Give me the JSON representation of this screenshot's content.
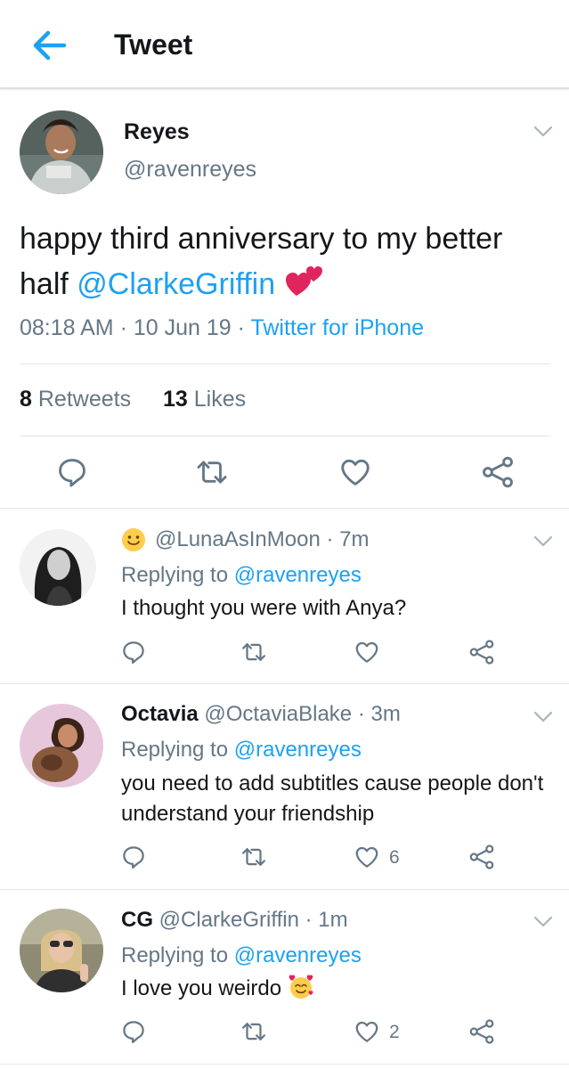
{
  "header": {
    "title": "Tweet"
  },
  "tweet": {
    "name": "Reyes",
    "handle": "@ravenreyes",
    "text": "happy third anniversary to my better half",
    "mention": "@ClarkeGriffin",
    "time": "08:18 AM",
    "date": "10 Jun 19",
    "source": "Twitter for iPhone",
    "retweets_count": "8",
    "retweets_label": "Retweets",
    "likes_count": "13",
    "likes_label": "Likes"
  },
  "replies": [
    {
      "name": "",
      "handle": "@LunaAsInMoon",
      "time": "7m",
      "replying_label": "Replying to",
      "replying_handle": "@ravenreyes",
      "text": "I thought you were with Anya?",
      "like_count": ""
    },
    {
      "name": "Octavia",
      "handle": "@OctaviaBlake",
      "time": "3m",
      "replying_label": "Replying to",
      "replying_handle": "@ravenreyes",
      "text": "you need to add subtitles cause people don't understand your friendship",
      "like_count": "6"
    },
    {
      "name": "CG",
      "handle": "@ClarkeGriffin",
      "time": "1m",
      "replying_label": "Replying to",
      "replying_handle": "@ravenreyes",
      "text": "I love you weirdo",
      "like_count": "2"
    }
  ],
  "colors": {
    "accent": "#1da1f2",
    "muted": "#657786",
    "text": "#14171a",
    "heart_emoji": "#e0245e"
  },
  "icons": [
    "back-arrow-icon",
    "chevron-down-icon",
    "reply-icon",
    "retweet-icon",
    "like-icon",
    "share-icon",
    "hearts-emoji-icon",
    "smiley-emoji-icon",
    "smiling-hearts-emoji-icon"
  ]
}
